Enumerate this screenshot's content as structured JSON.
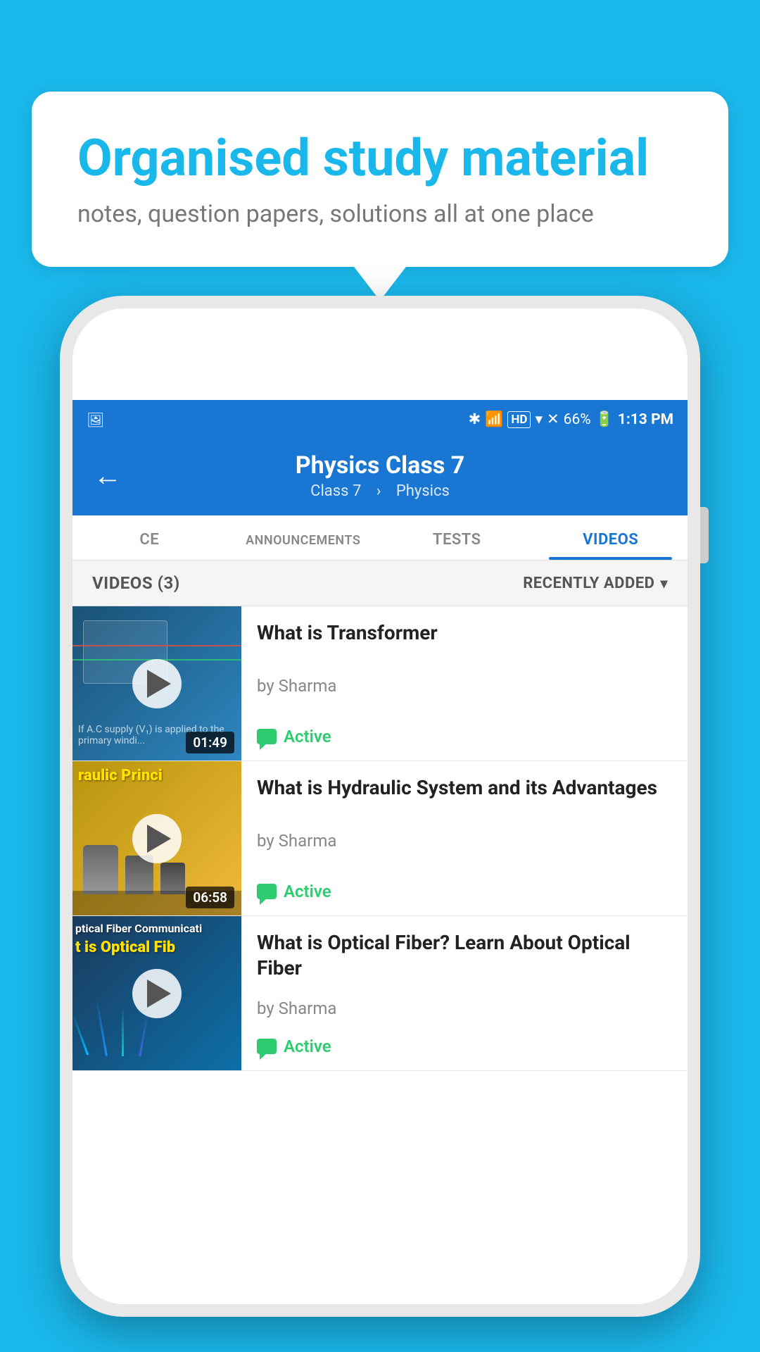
{
  "bubble": {
    "title": "Organised study material",
    "subtitle": "notes, question papers, solutions all at one place"
  },
  "phone": {
    "statusBar": {
      "time": "1:13 PM",
      "battery": "66%",
      "icons": "bluetooth vibrate hd wifi signal"
    },
    "appBar": {
      "title": "Physics Class 7",
      "breadcrumb1": "Class 7",
      "breadcrumb2": "Physics",
      "backLabel": "←"
    },
    "tabs": [
      {
        "label": "CE",
        "active": false
      },
      {
        "label": "ANNOUNCEMENTS",
        "active": false
      },
      {
        "label": "TESTS",
        "active": false
      },
      {
        "label": "VIDEOS",
        "active": true
      }
    ],
    "listHeader": {
      "count": "VIDEOS (3)",
      "sortLabel": "RECENTLY ADDED",
      "sortIcon": "chevron-down"
    },
    "videos": [
      {
        "title": "What is  Transformer",
        "author": "by Sharma",
        "status": "Active",
        "duration": "01:49",
        "thumbType": "dark-blue",
        "thumbText": ""
      },
      {
        "title": "What is Hydraulic System and its Advantages",
        "author": "by Sharma",
        "status": "Active",
        "duration": "06:58",
        "thumbType": "yellow",
        "thumbText": "raulic Princi"
      },
      {
        "title": "What is Optical Fiber? Learn About Optical Fiber",
        "author": "by Sharma",
        "status": "Active",
        "duration": "",
        "thumbType": "dark-navy",
        "thumbText": "ptical Fiber Communicati"
      }
    ]
  }
}
